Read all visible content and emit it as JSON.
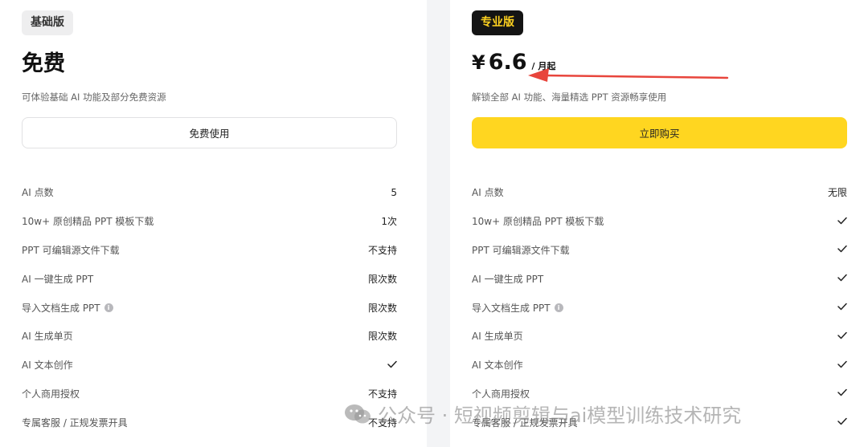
{
  "plans": [
    {
      "badge": "基础版",
      "price_text": "免费",
      "description": "可体验基础 AI 功能及部分免费资源",
      "cta": "免费使用",
      "features": [
        {
          "name": "AI 点数",
          "value": "5"
        },
        {
          "name": "10w+ 原创精品 PPT 模板下载",
          "value": "1次"
        },
        {
          "name": "PPT 可编辑源文件下载",
          "value": "不支持"
        },
        {
          "name": "AI 一键生成 PPT",
          "value": "限次数"
        },
        {
          "name": "导入文档生成 PPT",
          "value": "限次数",
          "info": true
        },
        {
          "name": "AI 生成单页",
          "value": "限次数"
        },
        {
          "name": "AI 文本创作",
          "value": "check"
        },
        {
          "name": "个人商用授权",
          "value": "不支持"
        },
        {
          "name": "专属客服 / 正规发票开具",
          "value": "不支持"
        }
      ]
    },
    {
      "badge": "专业版",
      "currency": "¥",
      "price": "6.6",
      "unit": "/ 月起",
      "description": "解锁全部 AI 功能、海量精选 PPT 资源畅享使用",
      "cta": "立即购买",
      "features": [
        {
          "name": "AI 点数",
          "value": "无限"
        },
        {
          "name": "10w+ 原创精品 PPT 模板下载",
          "value": "check"
        },
        {
          "name": "PPT 可编辑源文件下载",
          "value": "check"
        },
        {
          "name": "AI 一键生成 PPT",
          "value": "check"
        },
        {
          "name": "导入文档生成 PPT",
          "value": "check",
          "info": true
        },
        {
          "name": "AI 生成单页",
          "value": "check"
        },
        {
          "name": "AI 文本创作",
          "value": "check"
        },
        {
          "name": "个人商用授权",
          "value": "check"
        },
        {
          "name": "专属客服 / 正规发票开具",
          "value": "check"
        }
      ]
    }
  ],
  "watermark": "公众号 · 短视频剪辑与ai模型训练技术研究",
  "colors": {
    "accent_yellow": "#ffd620",
    "badge_dark": "#141414",
    "badge_text_yellow": "#ffd21f",
    "arrow_red": "#e8453c"
  },
  "icons": {
    "check": "check-icon",
    "info": "info-icon",
    "wechat": "wechat-icon"
  }
}
